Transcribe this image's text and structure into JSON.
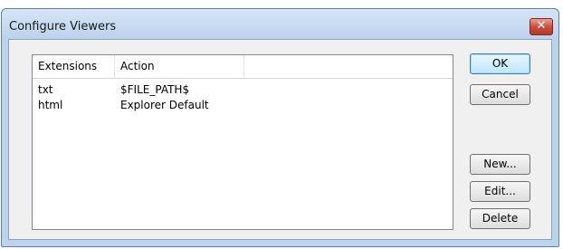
{
  "window": {
    "title": "Configure Viewers",
    "close_label": "✕"
  },
  "list": {
    "columns": [
      "Extensions",
      "Action",
      ""
    ],
    "rows": [
      {
        "extension": "txt",
        "action": "$FILE_PATH$"
      },
      {
        "extension": "html",
        "action": "Explorer Default"
      }
    ]
  },
  "buttons": {
    "ok": "OK",
    "cancel": "Cancel",
    "new": "New...",
    "edit": "Edit...",
    "delete": "Delete"
  }
}
